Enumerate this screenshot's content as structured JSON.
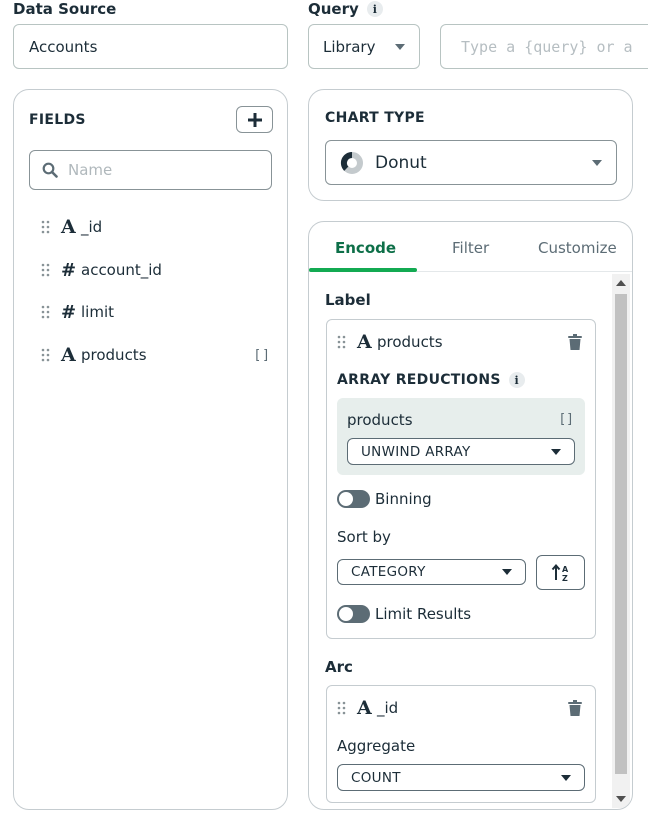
{
  "data_source": {
    "label": "Data Source",
    "value": "Accounts"
  },
  "query": {
    "label": "Query",
    "info_glyph": "i",
    "mode_value": "Library",
    "input_placeholder": "Type a {query} or a"
  },
  "fields_panel": {
    "title": "FIELDS",
    "add_icon": "plus-icon",
    "search_placeholder": "Name",
    "fields": [
      {
        "name": "_id",
        "type": "string",
        "type_glyph": "A"
      },
      {
        "name": "account_id",
        "type": "number",
        "type_glyph": "#"
      },
      {
        "name": "limit",
        "type": "number",
        "type_glyph": "#"
      },
      {
        "name": "products",
        "type": "array",
        "type_glyph": "A",
        "array_glyph": "[]"
      }
    ]
  },
  "chart_type": {
    "title": "CHART TYPE",
    "selected": "Donut",
    "icon": "donut-chart-icon"
  },
  "encode_panel": {
    "tabs": [
      {
        "label": "Encode",
        "active": true
      },
      {
        "label": "Filter",
        "active": false
      },
      {
        "label": "Customize",
        "active": false
      }
    ],
    "label_section": {
      "title": "Label",
      "field": {
        "name": "products",
        "type_glyph": "A"
      },
      "array_reductions_title": "ARRAY REDUCTIONS",
      "info_glyph": "i",
      "reduction": {
        "field": "products",
        "array_glyph": "[]",
        "method": "UNWIND ARRAY"
      },
      "binning_label": "Binning",
      "binning_on": false,
      "sort_by_label": "Sort by",
      "sort_by_value": "CATEGORY",
      "sort_icon": "sort-ascending-az-icon",
      "limit_results_label": "Limit Results",
      "limit_results_on": false
    },
    "arc_section": {
      "title": "Arc",
      "field": {
        "name": "_id",
        "type_glyph": "A"
      },
      "aggregate_label": "Aggregate",
      "aggregate_value": "COUNT"
    }
  },
  "colors": {
    "accent_green": "#13aa52",
    "active_tab_text": "#0d6f48",
    "text_primary": "#1c2d38",
    "border": "#c5ccd0",
    "toggle_off": "#5c6c75"
  }
}
